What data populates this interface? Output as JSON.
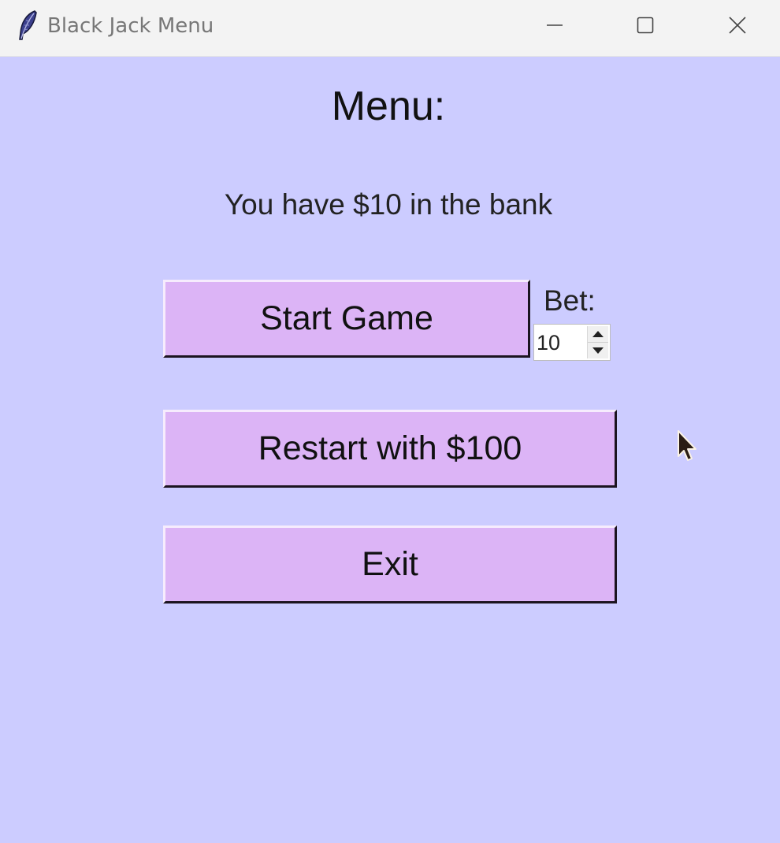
{
  "window": {
    "title": "Black Jack Menu",
    "app_icon": "feather-icon",
    "controls": [
      "minimize-icon",
      "maximize-icon",
      "close-icon"
    ]
  },
  "menu": {
    "title": "Menu:",
    "bank_text": "You have $10 in the bank"
  },
  "buttons": {
    "start_game": "Start Game",
    "restart": "Restart with $100",
    "exit": "Exit"
  },
  "bet": {
    "label": "Bet:",
    "value": "10"
  },
  "colors": {
    "background": "#ccccff",
    "button": "#dcb4f6",
    "titlebar": "#f3f3f3"
  }
}
